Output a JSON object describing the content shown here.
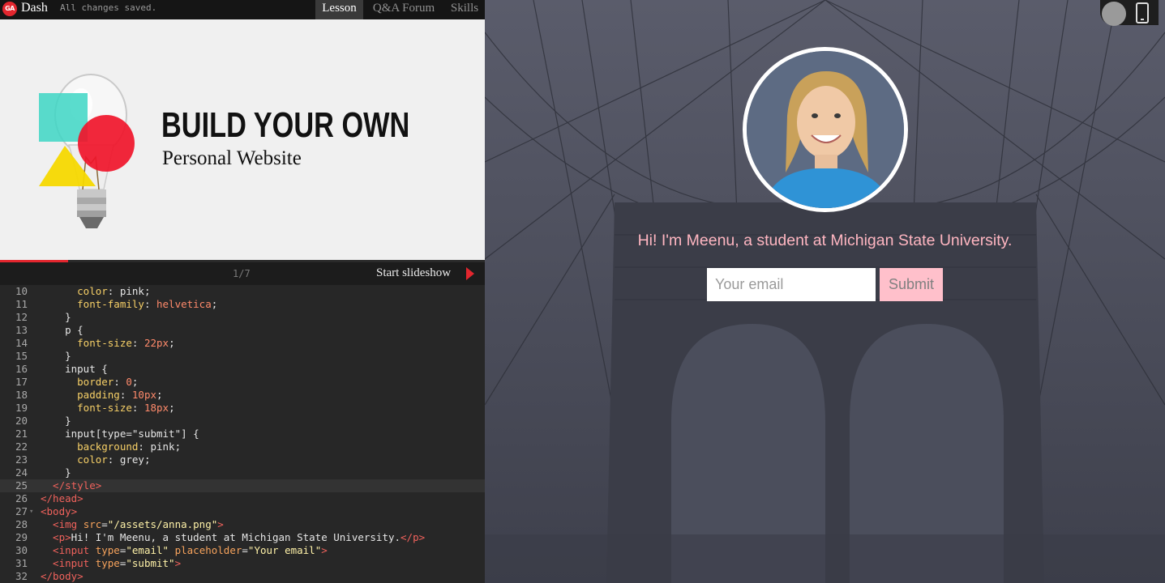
{
  "topbar": {
    "logo_text": "GA",
    "app_name": "Dash",
    "save_status": "All changes saved.",
    "tabs": [
      {
        "label": "Lesson",
        "active": true
      },
      {
        "label": "Q&A Forum",
        "active": false
      },
      {
        "label": "Skills",
        "active": false
      }
    ]
  },
  "slide": {
    "title": "BUILD YOUR OWN",
    "subtitle": "Personal Website",
    "counter": "1/7",
    "progress_fraction": 0.14,
    "slideshow_label": "Start slideshow"
  },
  "editor": {
    "active_line": 25,
    "lines": [
      {
        "n": "10",
        "tokens": [
          [
            "c-prop",
            "      color"
          ],
          [
            "c-plain",
            ": pink;"
          ]
        ]
      },
      {
        "n": "11",
        "tokens": [
          [
            "c-prop",
            "      font-family"
          ],
          [
            "c-plain",
            ": "
          ],
          [
            "c-orange",
            "helvetica"
          ],
          [
            "c-plain",
            ";"
          ]
        ]
      },
      {
        "n": "12",
        "tokens": [
          [
            "c-plain",
            "    }"
          ]
        ]
      },
      {
        "n": "13",
        "tokens": [
          [
            "c-plain",
            "    p {"
          ]
        ]
      },
      {
        "n": "14",
        "tokens": [
          [
            "c-prop",
            "      font-size"
          ],
          [
            "c-plain",
            ": "
          ],
          [
            "c-num",
            "22px"
          ],
          [
            "c-plain",
            ";"
          ]
        ]
      },
      {
        "n": "15",
        "tokens": [
          [
            "c-plain",
            "    }"
          ]
        ]
      },
      {
        "n": "16",
        "tokens": [
          [
            "c-plain",
            "    input {"
          ]
        ]
      },
      {
        "n": "17",
        "tokens": [
          [
            "c-prop",
            "      border"
          ],
          [
            "c-plain",
            ": "
          ],
          [
            "c-num",
            "0"
          ],
          [
            "c-plain",
            ";"
          ]
        ]
      },
      {
        "n": "18",
        "tokens": [
          [
            "c-prop",
            "      padding"
          ],
          [
            "c-plain",
            ": "
          ],
          [
            "c-num",
            "10px"
          ],
          [
            "c-plain",
            ";"
          ]
        ]
      },
      {
        "n": "19",
        "tokens": [
          [
            "c-prop",
            "      font-size"
          ],
          [
            "c-plain",
            ": "
          ],
          [
            "c-num",
            "18px"
          ],
          [
            "c-plain",
            ";"
          ]
        ]
      },
      {
        "n": "20",
        "tokens": [
          [
            "c-plain",
            "    }"
          ]
        ]
      },
      {
        "n": "21",
        "tokens": [
          [
            "c-plain",
            "    input[type=\"submit\"] {"
          ]
        ]
      },
      {
        "n": "22",
        "tokens": [
          [
            "c-prop",
            "      background"
          ],
          [
            "c-plain",
            ": pink;"
          ]
        ]
      },
      {
        "n": "23",
        "tokens": [
          [
            "c-prop",
            "      color"
          ],
          [
            "c-plain",
            ": grey;"
          ]
        ]
      },
      {
        "n": "24",
        "tokens": [
          [
            "c-plain",
            "    }"
          ]
        ]
      },
      {
        "n": "25",
        "tokens": [
          [
            "c-tag",
            "  </style>"
          ]
        ]
      },
      {
        "n": "26",
        "tokens": [
          [
            "c-tag",
            "</head>"
          ]
        ]
      },
      {
        "n": "27",
        "fold": true,
        "tokens": [
          [
            "c-tag",
            "<body>"
          ]
        ]
      },
      {
        "n": "28",
        "tokens": [
          [
            "c-tag",
            "  <img "
          ],
          [
            "c-attr",
            "src"
          ],
          [
            "c-plain",
            "="
          ],
          [
            "c-str",
            "\"/assets/anna.png\""
          ],
          [
            "c-tag",
            ">"
          ]
        ]
      },
      {
        "n": "29",
        "tokens": [
          [
            "c-tag",
            "  <p>"
          ],
          [
            "c-plain",
            "Hi! I'm Meenu, a student at Michigan State University."
          ],
          [
            "c-tag",
            "</p>"
          ]
        ]
      },
      {
        "n": "30",
        "tokens": [
          [
            "c-tag",
            "  <input "
          ],
          [
            "c-attr",
            "type"
          ],
          [
            "c-plain",
            "="
          ],
          [
            "c-str",
            "\"email\""
          ],
          [
            "c-plain",
            " "
          ],
          [
            "c-attr",
            "placeholder"
          ],
          [
            "c-plain",
            "="
          ],
          [
            "c-str",
            "\"Your email\""
          ],
          [
            "c-tag",
            ">"
          ]
        ]
      },
      {
        "n": "31",
        "tokens": [
          [
            "c-tag",
            "  <input "
          ],
          [
            "c-attr",
            "type"
          ],
          [
            "c-plain",
            "="
          ],
          [
            "c-str",
            "\"submit\""
          ],
          [
            "c-tag",
            ">"
          ]
        ]
      },
      {
        "n": "32",
        "tokens": [
          [
            "c-tag",
            "</body>"
          ]
        ]
      }
    ]
  },
  "preview": {
    "intro": "Hi! I'm Meenu, a student at Michigan State University.",
    "email_placeholder": "Your email",
    "submit_label": "Submit"
  },
  "colors": {
    "accent_red": "#e3262e",
    "pink": "#ffc0cb",
    "grey": "#808080"
  },
  "icons": [
    "play-icon",
    "phone-icon",
    "circle-toggle-icon",
    "ga-logo-icon"
  ]
}
